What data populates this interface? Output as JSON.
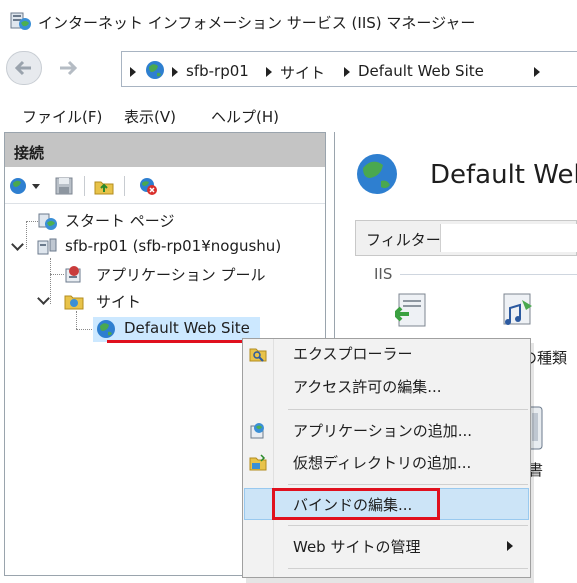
{
  "window": {
    "title": "インターネット インフォメーション サービス (IIS) マネージャー"
  },
  "address_bar": {
    "crumbs": [
      "sfb-rp01",
      "サイト",
      "Default Web Site"
    ]
  },
  "menu": {
    "items": [
      "ファイル(F)",
      "表示(V)",
      "ヘルプ(H)"
    ]
  },
  "connections": {
    "title": "接続",
    "tree": {
      "start_page": "スタート ページ",
      "server": "sfb-rp01 (sfb-rp01¥nogushu)",
      "app_pools": "アプリケーション プール",
      "sites": "サイト",
      "site": "Default Web Site"
    }
  },
  "right_panel": {
    "title": "Default Web",
    "filter_label": "フィルター:",
    "group_label": "IIS",
    "text1": "の種類",
    "text2": "書"
  },
  "context_menu": {
    "items": [
      {
        "label": "エクスプローラー"
      },
      {
        "label": "アクセス許可の編集..."
      },
      {
        "label": "アプリケーションの追加..."
      },
      {
        "label": "仮想ディレクトリの追加..."
      },
      {
        "label": "バインドの編集..."
      },
      {
        "label": "Web サイトの管理"
      }
    ]
  },
  "colors": {
    "highlight": "#cce4f7",
    "annotation_red": "#e0101e",
    "panel_header": "#c4c4c4"
  }
}
